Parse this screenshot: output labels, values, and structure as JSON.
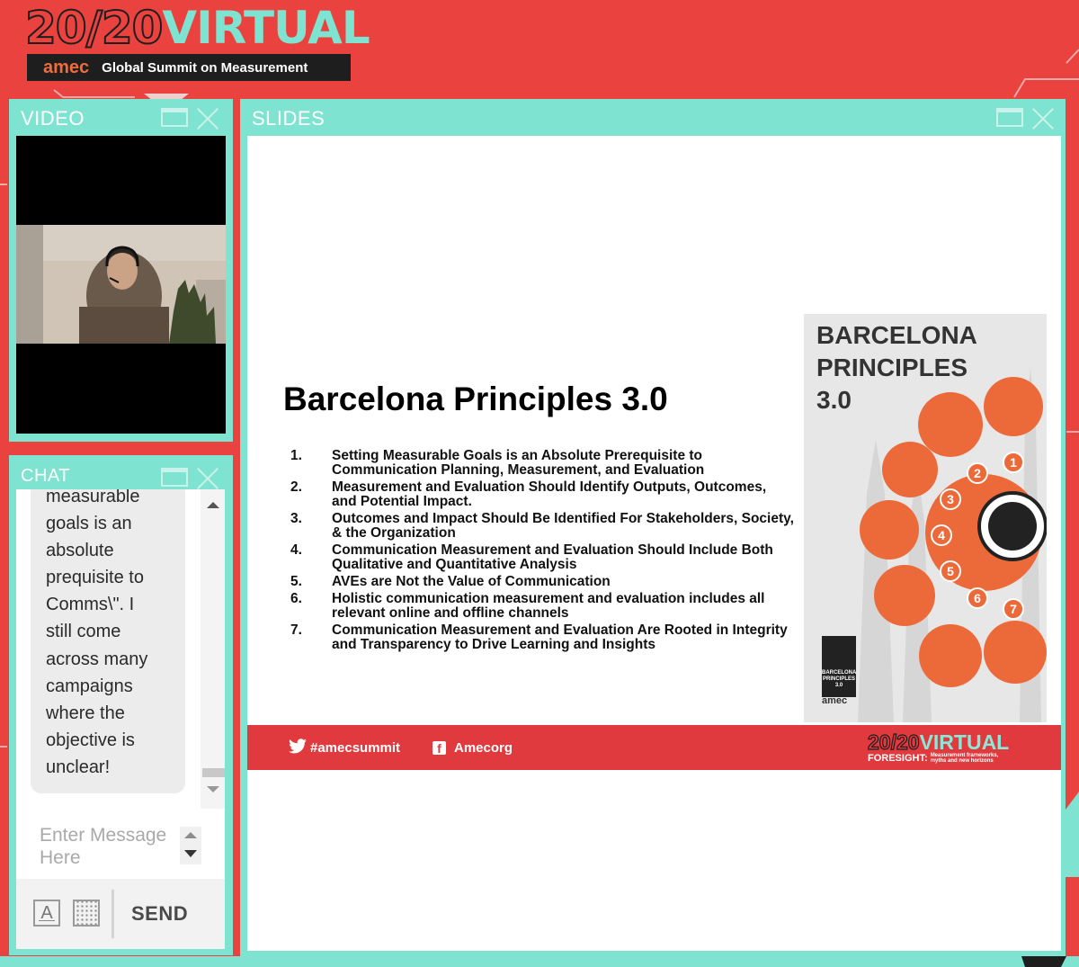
{
  "header": {
    "brand_number": "20/20",
    "brand_word": "VIRTUAL",
    "brand_org": "amec",
    "brand_tagline": "Global Summit on Measurement"
  },
  "video_panel": {
    "title": "VIDEO"
  },
  "chat_panel": {
    "title": "CHAT",
    "message_lines": [
      "measurable",
      "goals is an",
      "absolute",
      "prequisite to",
      "Comms\\\". I",
      "still come",
      "across many",
      "campaigns",
      "where the",
      "objective is",
      "unclear!"
    ],
    "input_placeholder": "Enter Message Here",
    "send_label": "SEND",
    "font_tool_glyph": "A"
  },
  "slides_panel": {
    "title": "SLIDES",
    "slide": {
      "title": "Barcelona Principles 3.0",
      "principles": [
        {
          "num": "1.",
          "text": "Setting Measurable Goals is an Absolute Prerequisite to Communication Planning, Measurement, and Evaluation"
        },
        {
          "num": "2.",
          "text": "Measurement and Evaluation Should Identify Outputs, Outcomes, and Potential Impact."
        },
        {
          "num": "3.",
          "text": "Outcomes and Impact Should Be Identified For Stakeholders, Society, & the Organization"
        },
        {
          "num": "4.",
          "text": "Communication Measurement and Evaluation Should Include Both Qualitative and Quantitative Analysis"
        },
        {
          "num": "5.",
          "text": "AVEs are Not the Value of Communication"
        },
        {
          "num": "6.",
          "text": "Holistic communication measurement and evaluation includes all relevant online and offline channels"
        },
        {
          "num": "7.",
          "text": "Communication Measurement and Evaluation Are Rooted in Integrity and Transparency to Drive Learning and Insights"
        }
      ],
      "graphic": {
        "title_line1": "BARCELONA",
        "title_line2": "PRINCIPLES",
        "title_line3": "3.0",
        "circle_numbers": [
          "1",
          "2",
          "3",
          "4",
          "5",
          "6",
          "7"
        ],
        "logo_text": "BARCELONA PRINCIPLES 3.0",
        "logo_org": "amec"
      },
      "footer": {
        "twitter": "#amecsummit",
        "facebook": "Amecorg",
        "brand_number": "20/20",
        "brand_word": "VIRTUAL",
        "sub_main": "FORESIGHT:",
        "sub_small_1": "Measurement frameworks,",
        "sub_small_2": "myths and new horizons"
      }
    }
  },
  "colors": {
    "background": "#e9423f",
    "panel_teal": "#7fe3d2",
    "slide_red": "#e0393e",
    "graphic_orange": "#ec6a3a"
  },
  "icons": [
    "maximize-icon",
    "close-icon",
    "scroll-up-icon",
    "scroll-down-icon",
    "font-icon",
    "keyboard-icon",
    "twitter-icon",
    "facebook-icon"
  ]
}
